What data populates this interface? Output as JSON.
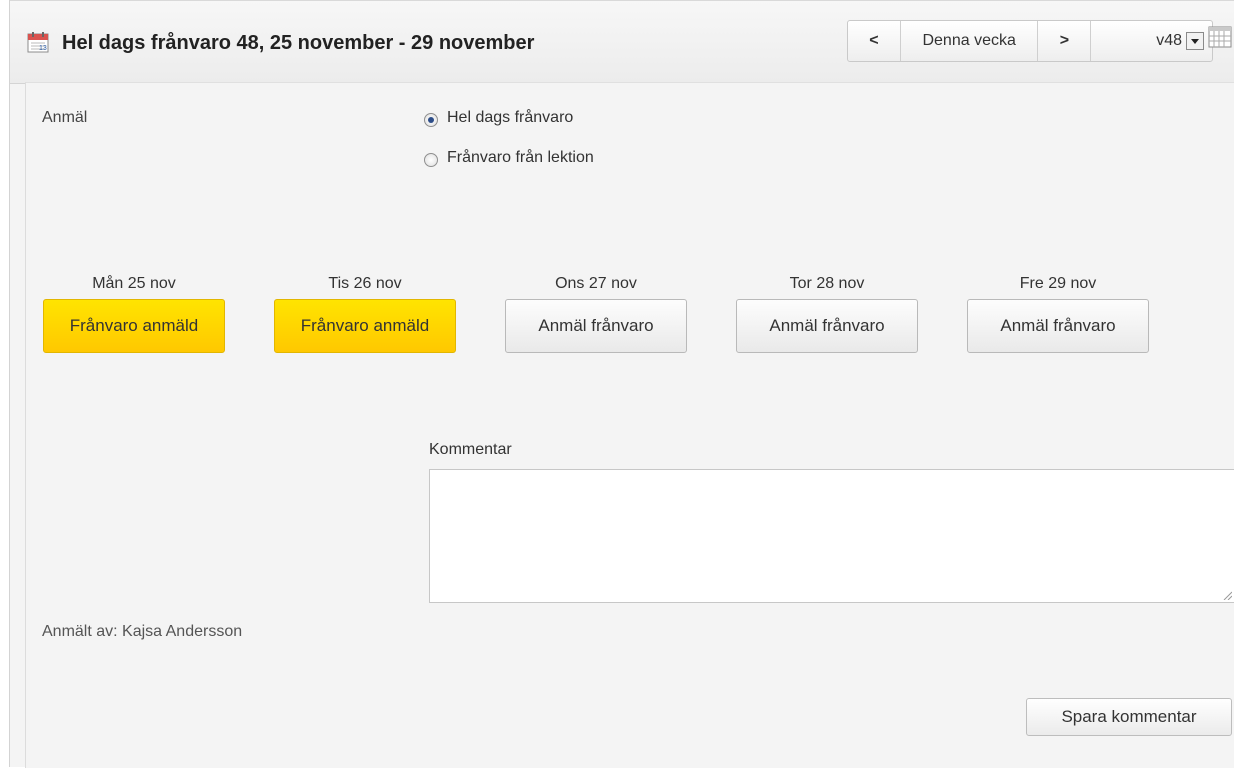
{
  "header": {
    "title": "Hel dags frånvaro 48, 25 november - 29 november",
    "prev_label": "<",
    "this_week_label": "Denna vecka",
    "next_label": ">",
    "week_selected": "v48"
  },
  "form": {
    "report_label": "Anmäl",
    "radio_options": [
      {
        "label": "Hel dags frånvaro",
        "checked": true
      },
      {
        "label": "Frånvaro från lektion",
        "checked": false
      }
    ],
    "days": [
      {
        "label": "Mån 25 nov",
        "button": "Frånvaro anmäld",
        "state": "reported"
      },
      {
        "label": "Tis 26 nov",
        "button": "Frånvaro anmäld",
        "state": "reported"
      },
      {
        "label": "Ons 27 nov",
        "button": "Anmäl frånvaro",
        "state": "open"
      },
      {
        "label": "Tor 28 nov",
        "button": "Anmäl frånvaro",
        "state": "open"
      },
      {
        "label": "Fre 29 nov",
        "button": "Anmäl frånvaro",
        "state": "open"
      }
    ],
    "comment_label": "Kommentar",
    "comment_value": "",
    "reported_by": "Anmält av: Kajsa Andersson",
    "save_label": "Spara kommentar"
  },
  "colors": {
    "reported_yellow": "#ffd400",
    "radio_dot": "#2d4d88",
    "calendar_icon_red": "#d9534f"
  },
  "icons": {
    "title": "calendar-icon",
    "dropdown": "chevron-down-icon",
    "grid": "calendar-grid-icon"
  }
}
